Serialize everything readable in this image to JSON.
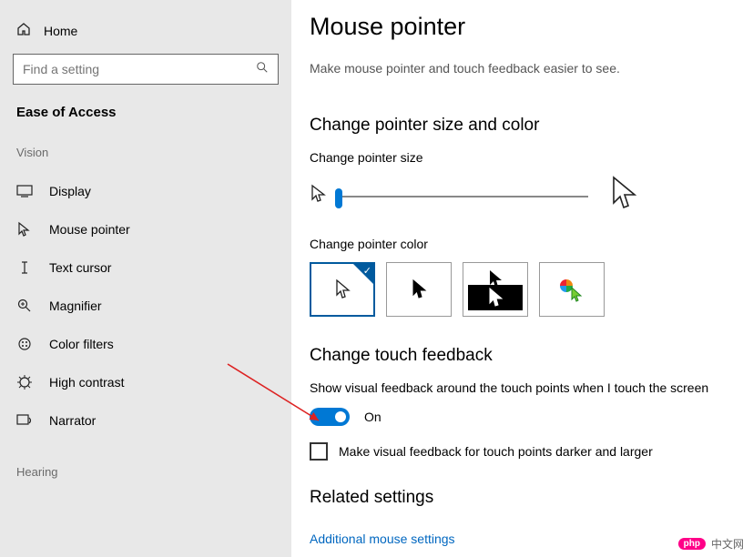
{
  "sidebar": {
    "home": "Home",
    "search_placeholder": "Find a setting",
    "ease_title": "Ease of Access",
    "vision_label": "Vision",
    "hearing_label": "Hearing",
    "items": [
      {
        "label": "Display"
      },
      {
        "label": "Mouse pointer"
      },
      {
        "label": "Text cursor"
      },
      {
        "label": "Magnifier"
      },
      {
        "label": "Color filters"
      },
      {
        "label": "High contrast"
      },
      {
        "label": "Narrator"
      }
    ]
  },
  "main": {
    "title": "Mouse pointer",
    "subtitle": "Make mouse pointer and touch feedback easier to see.",
    "section_size_color": "Change pointer size and color",
    "change_size": "Change pointer size",
    "change_color": "Change pointer color",
    "section_touch": "Change touch feedback",
    "touch_desc": "Show visual feedback around the touch points when I touch the screen",
    "toggle_state": "On",
    "checkbox_label": "Make visual feedback for touch points darker and larger",
    "section_related": "Related settings",
    "link_additional": "Additional mouse settings"
  },
  "watermark": {
    "badge": "php",
    "text": "中文网"
  }
}
